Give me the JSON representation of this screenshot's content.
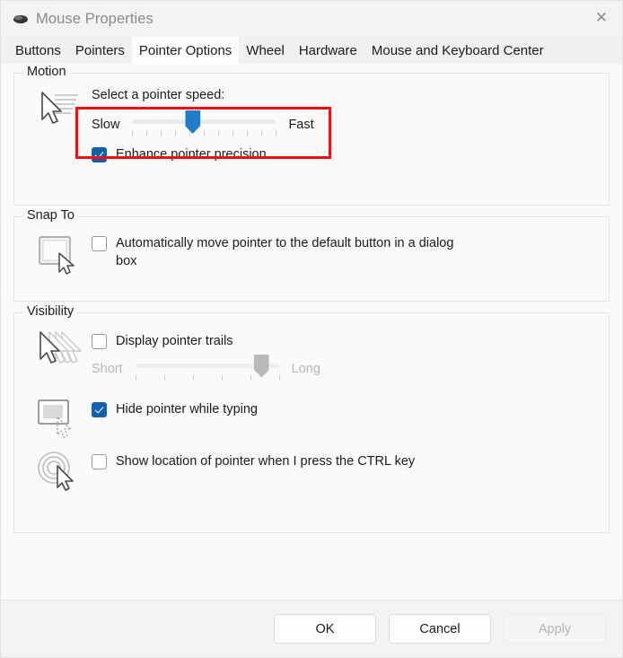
{
  "window": {
    "title": "Mouse Properties",
    "icon": "mouse-icon",
    "close_label": "✕"
  },
  "tabs": [
    {
      "label": "Buttons",
      "selected": false
    },
    {
      "label": "Pointers",
      "selected": false
    },
    {
      "label": "Pointer Options",
      "selected": true
    },
    {
      "label": "Wheel",
      "selected": false
    },
    {
      "label": "Hardware",
      "selected": false
    },
    {
      "label": "Mouse and Keyboard Center",
      "selected": false
    }
  ],
  "motion": {
    "legend": "Motion",
    "icon": "pointer-speed-icon",
    "speed_label": "Select a pointer speed:",
    "slider": {
      "min_label": "Slow",
      "max_label": "Fast",
      "value_percent": 42,
      "ticks": 11,
      "disabled": false
    },
    "enhance_precision": {
      "label": "Enhance pointer precision",
      "checked": true
    }
  },
  "snap_to": {
    "legend": "Snap To",
    "icon": "dialog-button-pointer-icon",
    "auto_move": {
      "label": "Automatically move pointer to the default button in a dialog box",
      "checked": false
    }
  },
  "visibility": {
    "legend": "Visibility",
    "items": [
      {
        "icon": "pointer-trails-icon",
        "label": "Display pointer trails",
        "checked": false,
        "slider": {
          "min_label": "Short",
          "max_label": "Long",
          "value_percent": 88,
          "ticks": 6,
          "disabled": true
        }
      },
      {
        "icon": "hide-pointer-typing-icon",
        "label": "Hide pointer while typing",
        "checked": true
      },
      {
        "icon": "show-pointer-location-icon",
        "label": "Show location of pointer when I press the CTRL key",
        "checked": false
      }
    ]
  },
  "annotation": {
    "color": "#ee1111",
    "target": "pointer-speed-slider"
  },
  "footer": {
    "ok": "OK",
    "cancel": "Cancel",
    "apply": "Apply",
    "apply_disabled": true
  }
}
